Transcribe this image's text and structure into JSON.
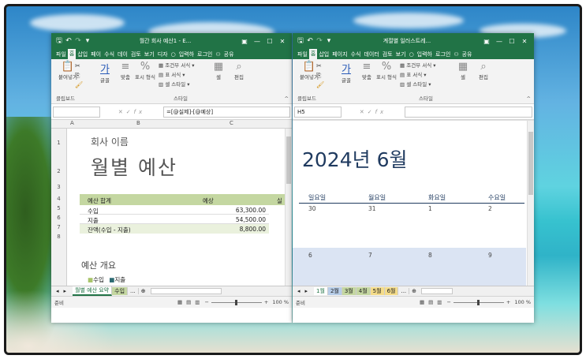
{
  "window1": {
    "title": "월간 회사 예산1 - E...",
    "tabs": [
      "파일",
      "홈",
      "삽입",
      "페이",
      "수식",
      "데이",
      "검토",
      "보기",
      "디자"
    ],
    "tell_me": "입력하",
    "login": "로그인",
    "share": "공유",
    "ribbon": {
      "paste": "붙여넣기",
      "font": "글꼴",
      "align": "맞춤",
      "number": "표시 형식",
      "cond_format": "조건부 서식",
      "table_format": "표 서식",
      "cell_style": "셀 스타일",
      "cells": "셀",
      "edit": "편집",
      "clipboard_group": "클립보드",
      "style_group": "스타일"
    },
    "name_box": "",
    "formula": "=[@실제]-[@예상]",
    "columns": [
      "A",
      "B",
      "C"
    ],
    "rows": [
      "1",
      "2",
      "3",
      "4",
      "5",
      "6",
      "7",
      "8"
    ],
    "company": "회사 이름",
    "heading": "월별 예산",
    "table": {
      "headers": [
        "예산 합계",
        "예상",
        "실"
      ],
      "rows": [
        {
          "label": "수입",
          "value": "63,300.00"
        },
        {
          "label": "지출",
          "value": "54,500.00"
        },
        {
          "label": "잔액(수입 - 지출)",
          "value": "8,800.00"
        }
      ]
    },
    "overview_title": "예산 개요",
    "legend": [
      "수입",
      "지출"
    ],
    "sheet_tabs": [
      "월별 예산 요약",
      "수입",
      "..."
    ],
    "status": "준비",
    "zoom": "100 %",
    "colors": {
      "green": "#217346",
      "header_fill": "#c4d7a1",
      "total_fill": "#eaf1dd"
    }
  },
  "window2": {
    "title": "계절별 일러스트레...",
    "tabs": [
      "파일",
      "홈",
      "삽입",
      "페이지",
      "수식",
      "데이터",
      "검토",
      "보기"
    ],
    "tell_me": "입력하",
    "login": "로그인",
    "share": "공유",
    "ribbon": {
      "paste": "붙여넣기",
      "font": "글꼴",
      "align": "맞춤",
      "number": "표시 형식",
      "cond_format": "조건부 서식",
      "table_format": "표 서식",
      "cell_style": "셀 스타일",
      "cells": "셀",
      "edit": "편집",
      "clipboard_group": "클립보드",
      "style_group": "스타일"
    },
    "name_box": "H5",
    "formula": "",
    "calendar_title": "2024년 6월",
    "weekdays": [
      "일요일",
      "월요일",
      "화요일",
      "수요일"
    ],
    "week1": [
      "30",
      "31",
      "1",
      "2"
    ],
    "week2": [
      "6",
      "7",
      "8",
      "9"
    ],
    "sheet_tabs": [
      "1월",
      "2월",
      "3월",
      "4월",
      "5월",
      "6월",
      "..."
    ],
    "status": "준비",
    "zoom": "100 %",
    "colors": {
      "green": "#217346",
      "week_band": "#dbe4f3",
      "title_text": "#1f3a5f"
    }
  }
}
